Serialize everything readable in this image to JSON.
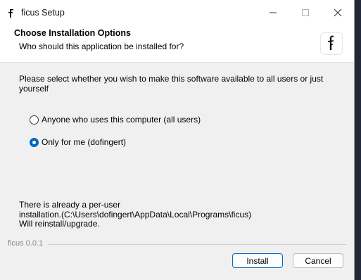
{
  "window": {
    "title": "ficus Setup"
  },
  "header": {
    "title": "Choose Installation Options",
    "subtitle": "Who should this application be installed for?"
  },
  "body": {
    "intro": "Please select whether you wish to make this software available to all users or just yourself",
    "options": [
      {
        "label": "Anyone who uses this computer (all users)",
        "selected": false
      },
      {
        "label": "Only for me (dofingert)",
        "selected": true
      }
    ],
    "note_lines": [
      "There is already a per-user",
      "installation.(C:\\Users\\dofingert\\AppData\\Local\\Programs\\ficus)",
      "Will reinstall/upgrade."
    ]
  },
  "footer": {
    "branding": "ficus 0.0.1",
    "install_label": "Install",
    "cancel_label": "Cancel"
  },
  "colors": {
    "accent": "#0067c0",
    "dialog_bg": "#f0f0f0",
    "header_bg": "#ffffff"
  }
}
